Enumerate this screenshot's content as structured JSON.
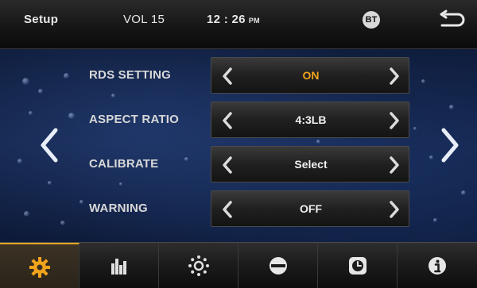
{
  "header": {
    "title": "Setup",
    "volume": "VOL 15",
    "time": "12 : 26",
    "ampm": "PM",
    "bluetooth_label": "BT"
  },
  "settings": [
    {
      "label": "RDS SETTING",
      "value": "ON"
    },
    {
      "label": "ASPECT RATIO",
      "value": "4:3LB"
    },
    {
      "label": "CALIBRATE",
      "value": "Select"
    },
    {
      "label": "WARNING",
      "value": "OFF"
    }
  ],
  "bottom_tabs": [
    {
      "name": "general-settings",
      "icon": "gear-icon",
      "active": true
    },
    {
      "name": "equalizer",
      "icon": "equalizer-icon",
      "active": false
    },
    {
      "name": "brightness",
      "icon": "sun-icon",
      "active": false
    },
    {
      "name": "disc",
      "icon": "disc-icon",
      "active": false
    },
    {
      "name": "clock",
      "icon": "clock-icon",
      "active": false
    },
    {
      "name": "info",
      "icon": "info-icon",
      "active": false
    }
  ],
  "colors": {
    "accent": "#f2a31c",
    "background": "#142449",
    "bar": "#1c1c1c"
  }
}
